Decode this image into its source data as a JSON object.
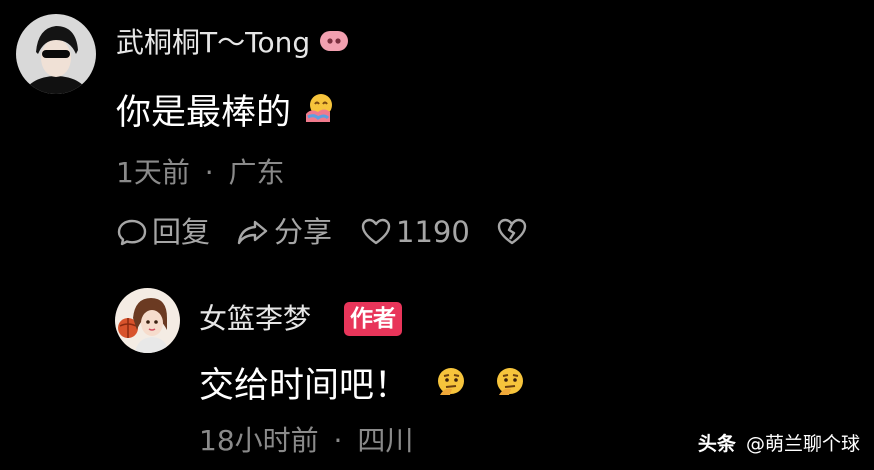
{
  "comment": {
    "username": "武桐桐T～Tong",
    "text": "你是最棒的",
    "emoji_icon": "hug-emoji",
    "time": "1天前",
    "separator": "·",
    "location": "广东",
    "reply_label": "回复",
    "share_label": "分享",
    "like_count": "1190"
  },
  "reply": {
    "username": "女篮李梦",
    "badge": "作者",
    "text": "交给时间吧！",
    "emoji_icons": [
      "thinking-emoji",
      "thinking-emoji"
    ],
    "time": "18小时前",
    "separator": "·",
    "location": "四川"
  },
  "watermark": {
    "brand": "头条",
    "handle": "@萌兰聊个球"
  },
  "colors": {
    "background": "#000000",
    "text_primary": "#ffffff",
    "text_secondary": "#8a8a8a",
    "badge": "#e8355a",
    "pig_icon": "#f2a0b0"
  }
}
